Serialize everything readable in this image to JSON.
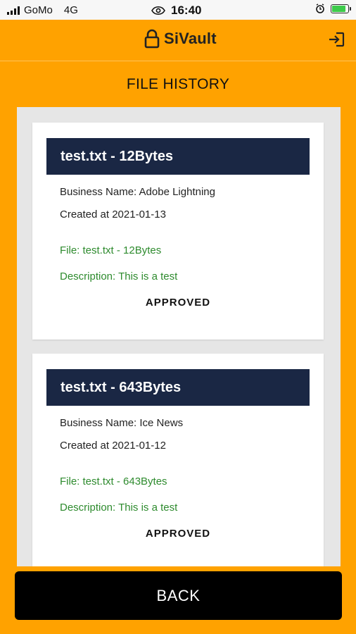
{
  "status_bar": {
    "carrier": "GoMo",
    "network": "4G",
    "time": "16:40",
    "battery_level": 0.85
  },
  "header": {
    "app_name": "SiVault"
  },
  "page": {
    "title": "FILE HISTORY"
  },
  "files": [
    {
      "title": "test.txt - 12Bytes",
      "business_name": "Business Name: Adobe Lightning",
      "created_at": "Created at 2021-01-13",
      "file": "File: test.txt - 12Bytes",
      "description": "Description: This is a test",
      "status": "APPROVED"
    },
    {
      "title": "test.txt - 643Bytes",
      "business_name": "Business Name: Ice News",
      "created_at": "Created at 2021-01-12",
      "file": "File: test.txt - 643Bytes",
      "description": "Description: This is a test",
      "status": "APPROVED"
    }
  ],
  "footer": {
    "back_label": "BACK"
  },
  "colors": {
    "background": "#FFA200",
    "card_header": "#1A2744",
    "accent_green": "#2E8B2E",
    "button": "#000000"
  }
}
